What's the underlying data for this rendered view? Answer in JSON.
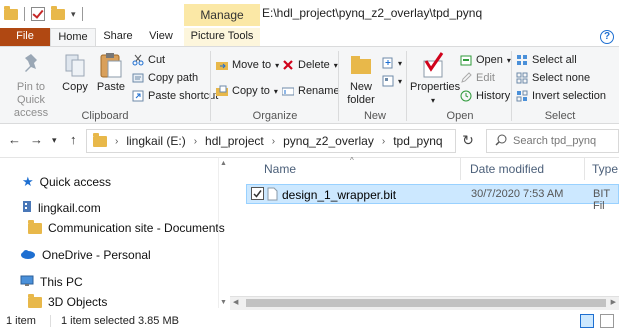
{
  "window": {
    "title": "E:\\hdl_project\\pynq_z2_overlay\\tpd_pynq",
    "context_tab_header": "Manage"
  },
  "tabs": [
    "File",
    "Home",
    "Share",
    "View",
    "Picture Tools",
    "?"
  ],
  "ribbon": {
    "clipboard": {
      "pin_label": "Pin to Quick access",
      "copy_label": "Copy",
      "paste_label": "Paste",
      "cut_label": "Cut",
      "copy_path_label": "Copy path",
      "paste_shortcut_label": "Paste shortcut",
      "group_label": "Clipboard"
    },
    "organize": {
      "move_to_label": "Move to",
      "copy_to_label": "Copy to",
      "delete_label": "Delete",
      "rename_label": "Rename",
      "group_label": "Organize"
    },
    "new": {
      "new_folder_label": "New folder",
      "group_label": "New"
    },
    "open": {
      "properties_label": "Properties",
      "open_label": "Open",
      "edit_label": "Edit",
      "history_label": "History",
      "group_label": "Open"
    },
    "select": {
      "select_all_label": "Select all",
      "select_none_label": "Select none",
      "invert_label": "Invert selection",
      "group_label": "Select"
    }
  },
  "address": {
    "crumbs": [
      "lingkail (E:)",
      "hdl_project",
      "pynq_z2_overlay",
      "tpd_pynq"
    ],
    "search_placeholder": "Search tpd_pynq"
  },
  "nav": {
    "items": [
      "Quick access",
      "lingkail.com",
      "Communication site - Documents",
      "OneDrive - Personal",
      "This PC",
      "3D Objects"
    ]
  },
  "list": {
    "columns": [
      "Name",
      "Date modified",
      "Type"
    ],
    "rows": [
      {
        "name": "design_1_wrapper.bit",
        "date": "30/7/2020 7:53 AM",
        "type": "BIT Fil"
      }
    ]
  },
  "status": {
    "count": "1 item",
    "selection": "1 item selected  3.85 MB"
  },
  "colors": {
    "file_tab": "#b04812",
    "context_tab": "#fbe8a6",
    "selection": "#cce8ff",
    "accent": "#1e6fd1"
  }
}
